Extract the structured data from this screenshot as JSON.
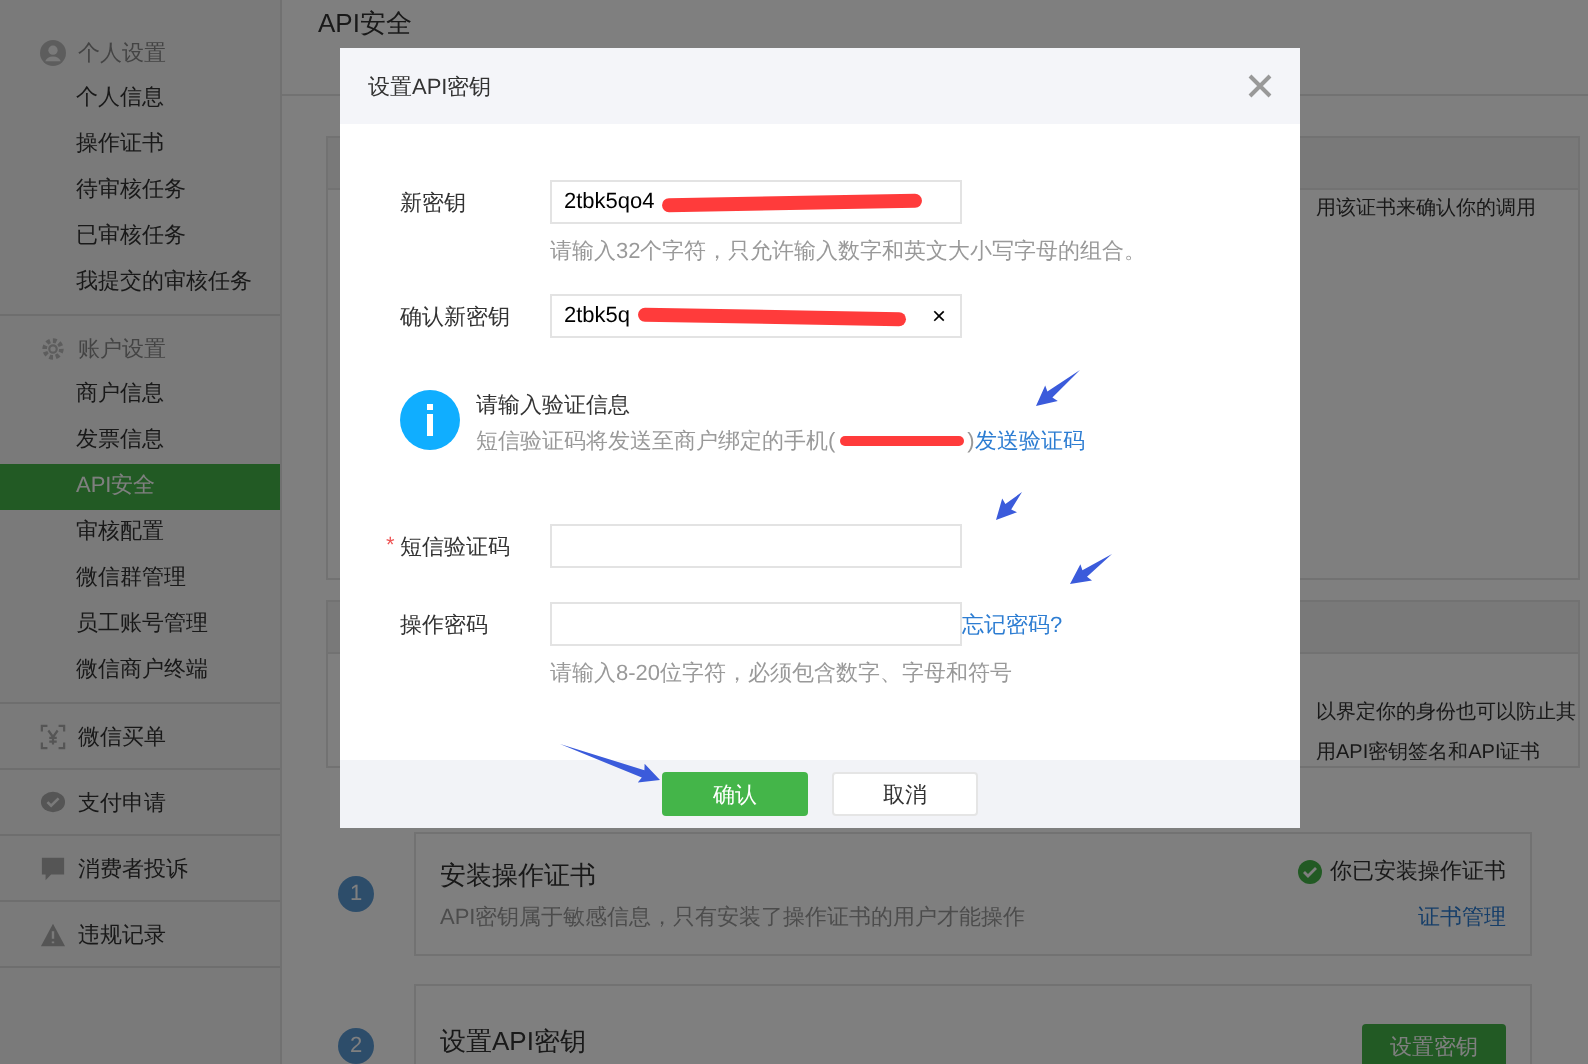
{
  "sidebar": {
    "sections": [
      {
        "title": "个人设置",
        "items": [
          {
            "label": "个人信息",
            "selected": false
          },
          {
            "label": "操作证书",
            "selected": false
          },
          {
            "label": "待审核任务",
            "selected": false
          },
          {
            "label": "已审核任务",
            "selected": false
          },
          {
            "label": "我提交的审核任务",
            "selected": false
          }
        ]
      },
      {
        "title": "账户设置",
        "items": [
          {
            "label": "商户信息",
            "selected": false
          },
          {
            "label": "发票信息",
            "selected": false
          },
          {
            "label": "API安全",
            "selected": true
          },
          {
            "label": "审核配置",
            "selected": false
          },
          {
            "label": "微信群管理",
            "selected": false
          },
          {
            "label": "员工账号管理",
            "selected": false
          },
          {
            "label": "微信商户终端",
            "selected": false
          }
        ]
      },
      {
        "title": "微信买单"
      },
      {
        "title": "支付申请"
      },
      {
        "title": "消费者投诉"
      },
      {
        "title": "违规记录"
      }
    ]
  },
  "page": {
    "title": "API安全",
    "panel_texts": [
      "用该证书来确认你的调用",
      "以界定你的身份也可以防止其",
      "用API密钥签名和API证书"
    ],
    "steps": [
      {
        "number": "1",
        "title": "安装操作证书",
        "description": "API密钥属于敏感信息，只有安装了操作证书的用户才能操作",
        "status": "你已安装操作证书",
        "link": "证书管理"
      },
      {
        "number": "2",
        "title": "设置API密钥",
        "button": "设置密钥"
      }
    ]
  },
  "dialog": {
    "title": "设置API密钥",
    "fields": [
      {
        "label": "新密钥",
        "value": "2tbk5qo4",
        "hint": "请输入32个字符，只允许输入数字和英文大小写字母的组合。"
      },
      {
        "label": "确认新密钥",
        "value": "2tbk5q",
        "clear": "×"
      }
    ],
    "info": {
      "title": "请输入验证信息",
      "description": "短信验证码将发送至商户绑定的手机(",
      "description_end": ")",
      "link": "发送验证码"
    },
    "auth_fields": [
      {
        "marker": "*",
        "label": "短信验证码"
      },
      {
        "label": "操作密码",
        "link": "忘记密码?",
        "hint": "请输入8-20位字符，必须包含数字、字母和符号"
      }
    ],
    "buttons": [
      {
        "label": "确认",
        "kind": "primary"
      },
      {
        "label": "取消",
        "kind": "default"
      }
    ]
  }
}
